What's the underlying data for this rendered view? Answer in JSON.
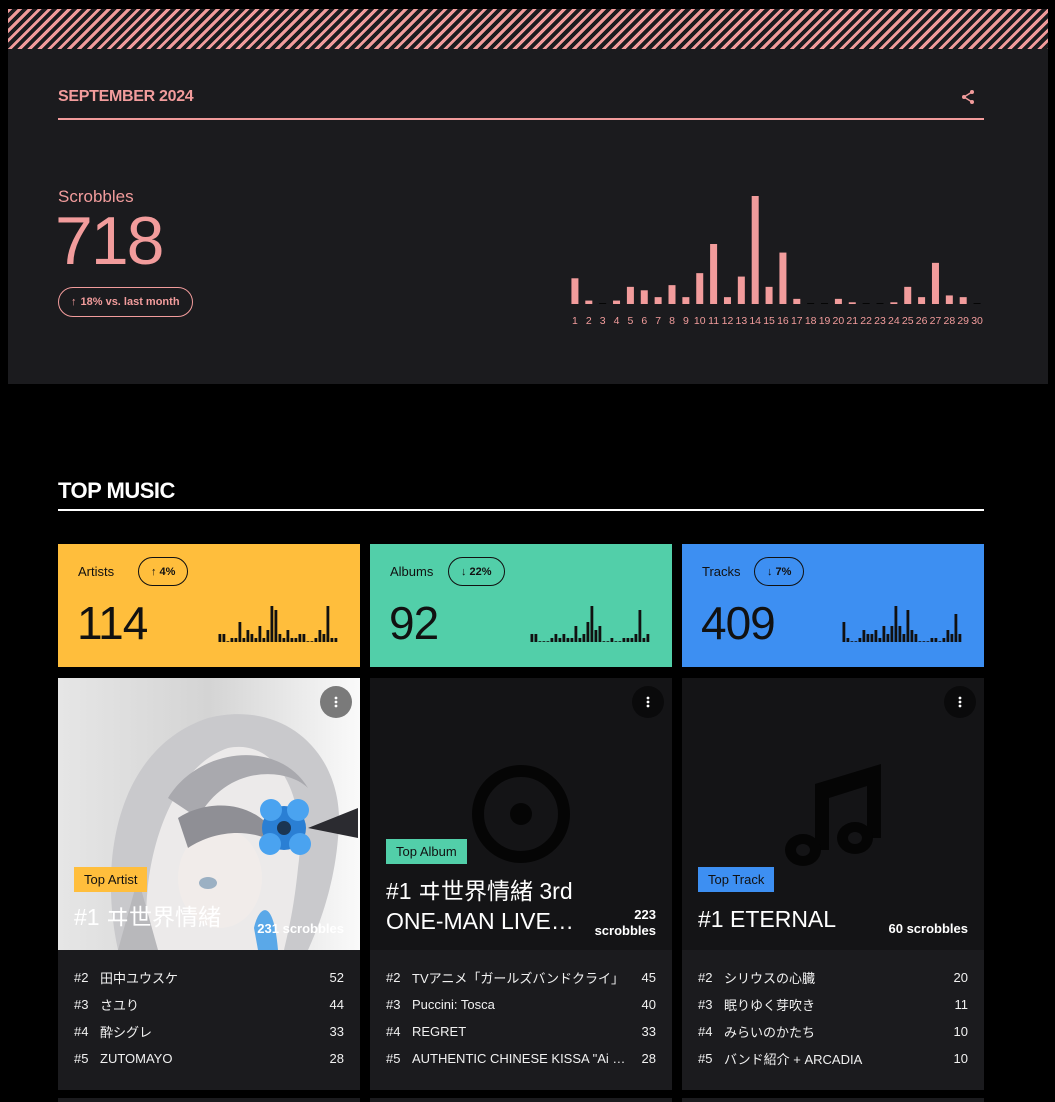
{
  "month": {
    "title": "SEPTEMBER 2024",
    "share_icon": "share-icon"
  },
  "scrobbles": {
    "label": "Scrobbles",
    "value": "718",
    "change": "18% vs. last month",
    "change_dir": "up",
    "accent": "#f29c9c"
  },
  "chart_data": {
    "type": "bar",
    "categories": [
      "1",
      "2",
      "3",
      "4",
      "5",
      "6",
      "7",
      "8",
      "9",
      "10",
      "11",
      "12",
      "13",
      "14",
      "15",
      "16",
      "17",
      "18",
      "19",
      "20",
      "21",
      "22",
      "23",
      "24",
      "25",
      "26",
      "27",
      "28",
      "29",
      "30"
    ],
    "values": [
      15,
      2,
      0,
      2,
      10,
      8,
      4,
      11,
      4,
      18,
      35,
      4,
      16,
      63,
      10,
      30,
      3,
      0,
      0,
      3,
      1,
      0,
      0,
      1,
      10,
      4,
      24,
      5,
      4,
      0
    ],
    "title": "",
    "xlabel": "",
    "ylabel": ""
  },
  "top_music": {
    "title": "TOP MUSIC",
    "stats": [
      {
        "label": "Artists",
        "change": "4%",
        "dir": "up",
        "value": "114",
        "color": "#ffbe3c",
        "spark": [
          2,
          2,
          0,
          1,
          1,
          5,
          1,
          3,
          2,
          1,
          4,
          1,
          3,
          9,
          8,
          2,
          1,
          3,
          1,
          1,
          2,
          2,
          0,
          0,
          1,
          3,
          2,
          9,
          1,
          1
        ]
      },
      {
        "label": "Albums",
        "change": "22%",
        "dir": "down",
        "value": "92",
        "color": "#52cfa9",
        "spark": [
          2,
          2,
          0,
          0,
          0,
          1,
          2,
          1,
          2,
          1,
          1,
          4,
          1,
          2,
          5,
          9,
          3,
          4,
          0,
          0,
          1,
          0,
          0,
          1,
          1,
          1,
          2,
          8,
          1,
          2
        ]
      },
      {
        "label": "Tracks",
        "change": "7%",
        "dir": "down",
        "value": "409",
        "color": "#3d8ff2",
        "spark": [
          5,
          1,
          0,
          0,
          1,
          3,
          2,
          2,
          3,
          1,
          4,
          2,
          4,
          9,
          4,
          2,
          8,
          3,
          2,
          0,
          0,
          0,
          1,
          1,
          0,
          1,
          3,
          2,
          7,
          2
        ]
      }
    ]
  },
  "cards": [
    {
      "tag": "Top Artist",
      "tag_color": "#ffbe3c",
      "name": "#1 ヰ世界情緒",
      "count": "231 scrobbles",
      "list": [
        {
          "rank": "#2",
          "name": "田中ユウスケ",
          "count": "52"
        },
        {
          "rank": "#3",
          "name": "さユり",
          "count": "44"
        },
        {
          "rank": "#4",
          "name": "酔シグレ",
          "count": "33"
        },
        {
          "rank": "#5",
          "name": "ZUTOMAYO",
          "count": "28"
        }
      ]
    },
    {
      "tag": "Top Album",
      "tag_color": "#52cfa9",
      "name": "#1 ヰ世界情緒 3rd ONE-MAN LIVE…",
      "count_line1": "223",
      "count_line2": "scrobbles",
      "list": [
        {
          "rank": "#2",
          "name": "TVアニメ「ガールズバンドクライ」",
          "count": "45"
        },
        {
          "rank": "#3",
          "name": "Puccini: Tosca",
          "count": "40"
        },
        {
          "rank": "#4",
          "name": "REGRET",
          "count": "33"
        },
        {
          "rank": "#5",
          "name": "AUTHENTIC CHINESE KISSA \"Ai no Shuuten\"",
          "count": "28"
        }
      ]
    },
    {
      "tag": "Top Track",
      "tag_color": "#3d8ff2",
      "name": "#1 ETERNAL",
      "count": "60 scrobbles",
      "list": [
        {
          "rank": "#2",
          "name": "シリウスの心臓",
          "count": "20"
        },
        {
          "rank": "#3",
          "name": "眠りゆく芽吹き",
          "count": "11"
        },
        {
          "rank": "#4",
          "name": "みらいのかたち",
          "count": "10"
        },
        {
          "rank": "#5",
          "name": "バンド紹介 + ARCADIA",
          "count": "10"
        }
      ]
    }
  ]
}
